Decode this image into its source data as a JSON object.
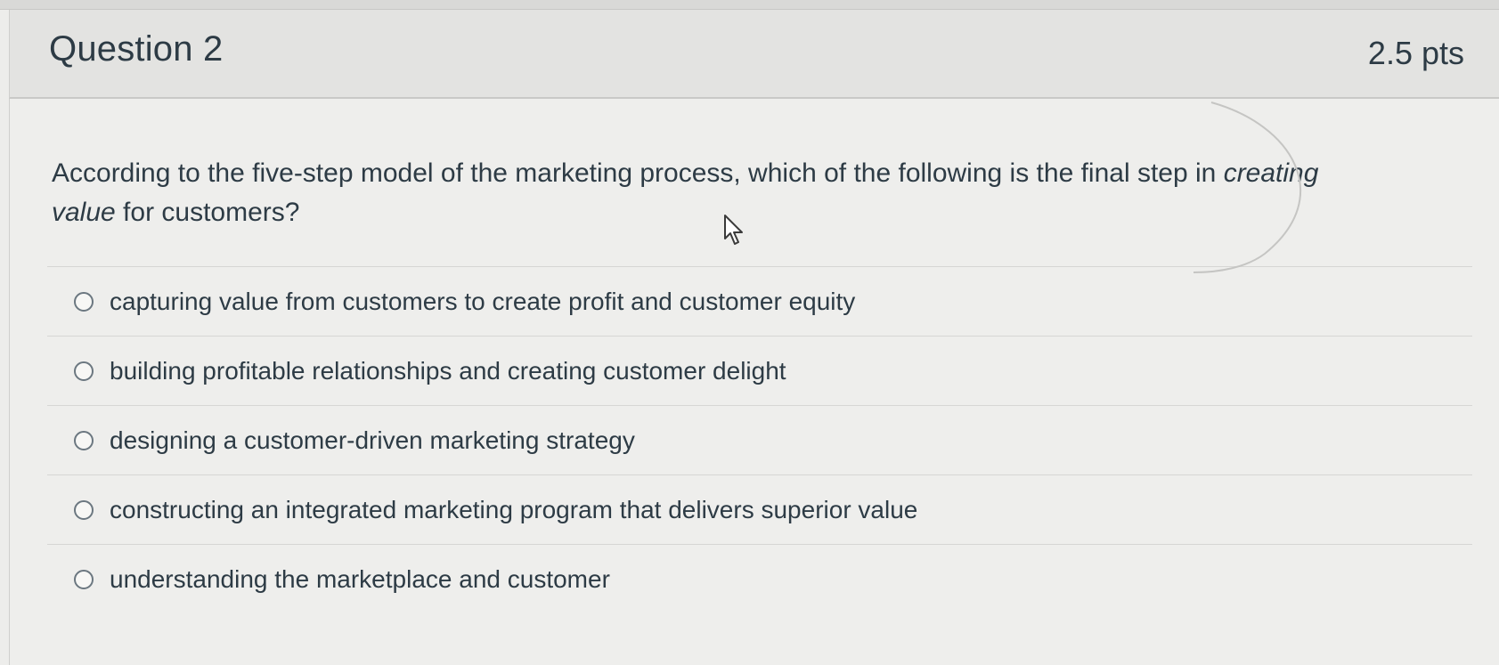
{
  "question": {
    "title": "Question 2",
    "points": "2.5 pts",
    "text_before": "According to the five-step model of the marketing process, which of the following is the final step in ",
    "text_emphasis": "creating value",
    "text_after": " for customers?"
  },
  "answers": [
    {
      "label": "capturing value from customers to create profit and customer equity"
    },
    {
      "label": "building profitable relationships and creating customer delight"
    },
    {
      "label": "designing a customer-driven marketing strategy"
    },
    {
      "label": "constructing an integrated marketing program that delivers superior value"
    },
    {
      "label": "understanding the marketplace and customer"
    }
  ],
  "icons": {
    "cursor": "mouse-pointer-icon",
    "radio": "radio-unselected"
  },
  "colors": {
    "text": "#2d3b45",
    "header_bg": "#e3e3e1",
    "body_bg": "#eeeeec"
  }
}
